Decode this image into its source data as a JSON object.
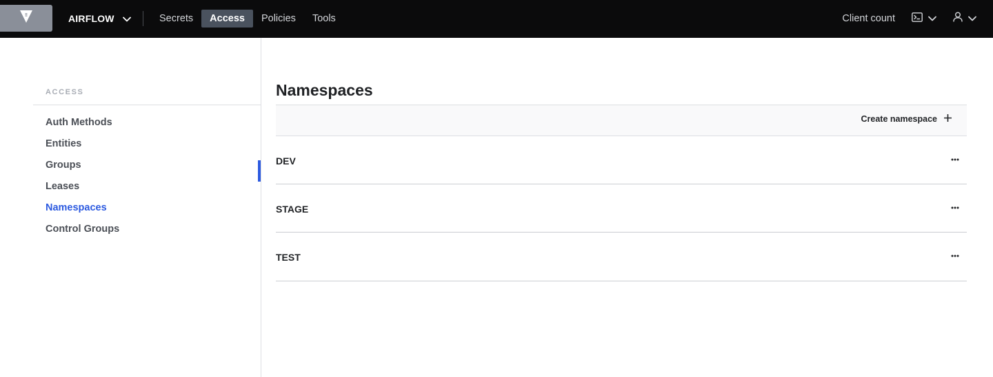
{
  "header": {
    "namespace_label": "AIRFLOW",
    "nav": [
      {
        "label": "Secrets",
        "active": false
      },
      {
        "label": "Access",
        "active": true
      },
      {
        "label": "Policies",
        "active": false
      },
      {
        "label": "Tools",
        "active": false
      }
    ],
    "client_count_label": "Client count",
    "icons": [
      "vault-logo-icon",
      "chevron-down-icon",
      "terminal-icon",
      "user-icon"
    ]
  },
  "sidebar": {
    "heading": "ACCESS",
    "items": [
      {
        "label": "Auth Methods",
        "active": false
      },
      {
        "label": "Entities",
        "active": false
      },
      {
        "label": "Groups",
        "active": false
      },
      {
        "label": "Leases",
        "active": false
      },
      {
        "label": "Namespaces",
        "active": true
      },
      {
        "label": "Control Groups",
        "active": false
      }
    ]
  },
  "main": {
    "title": "Namespaces",
    "create_label": "Create namespace",
    "namespaces": [
      {
        "name": "DEV"
      },
      {
        "name": "STAGE"
      },
      {
        "name": "TEST"
      }
    ]
  },
  "colors": {
    "accent": "#2c5ae0",
    "topbar": "#0b0b0c",
    "active_nav_bg": "#4a525e"
  }
}
